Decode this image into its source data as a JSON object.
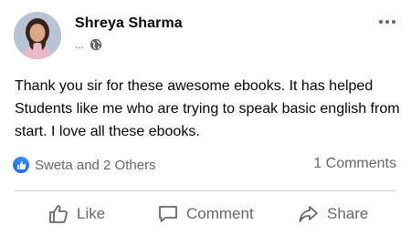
{
  "post": {
    "author": "Shreya Sharma",
    "meta_text": "...",
    "message": "Thank you sir for these awesome ebooks. It has helped Students like me who are trying to speak basic english from start. I love all these ebooks.",
    "reactions_text": "Sweta and 2 Others",
    "comments_text": "1 Comments"
  },
  "actions": {
    "like": "Like",
    "comment": "Comment",
    "share": "Share"
  },
  "icons": {
    "avatar": "profile-photo",
    "globe": "globe-icon",
    "more": "more-options-icon",
    "like_badge": "thumbs-up-icon",
    "like": "thumbs-up-outline-icon",
    "comment": "speech-bubble-icon",
    "share": "share-arrow-icon"
  },
  "colors": {
    "text": "#050505",
    "secondary": "#65676b",
    "like_blue": "#1877f2",
    "divider": "#ced0d4"
  }
}
